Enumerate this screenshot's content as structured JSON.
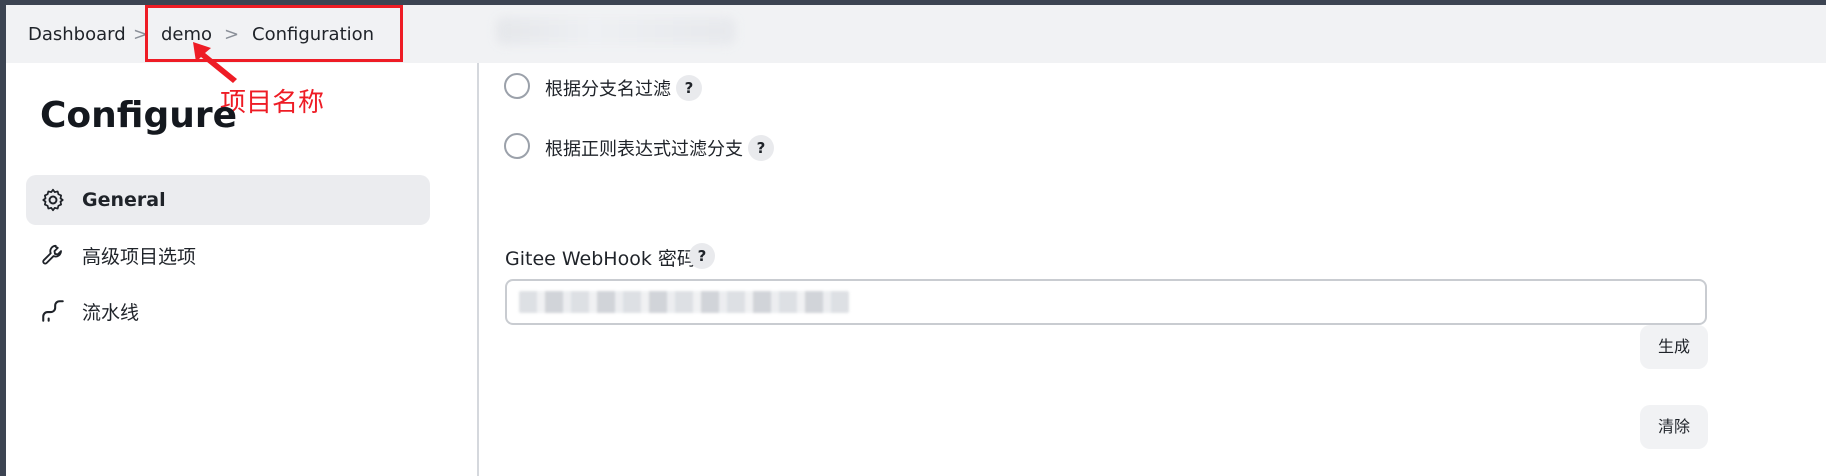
{
  "breadcrumb": {
    "items": [
      "Dashboard",
      "demo",
      "Configuration"
    ],
    "separator": ">"
  },
  "annotation": {
    "label": "项目名称",
    "color": "#ee1c25"
  },
  "sidebar": {
    "title": "Configure",
    "items": [
      {
        "label": "General",
        "icon": "gear-icon",
        "active": true
      },
      {
        "label": "高级项目选项",
        "icon": "wrench-icon",
        "active": false
      },
      {
        "label": "流水线",
        "icon": "pipeline-icon",
        "active": false
      }
    ]
  },
  "main": {
    "filters": [
      {
        "label": "根据分支名过滤",
        "help": "?"
      },
      {
        "label": "根据正则表达式过滤分支",
        "help": "?"
      }
    ],
    "webhook": {
      "label": "Gitee WebHook 密码",
      "help": "?",
      "value": ""
    },
    "buttons": {
      "generate": "生成",
      "clear": "清除"
    }
  }
}
